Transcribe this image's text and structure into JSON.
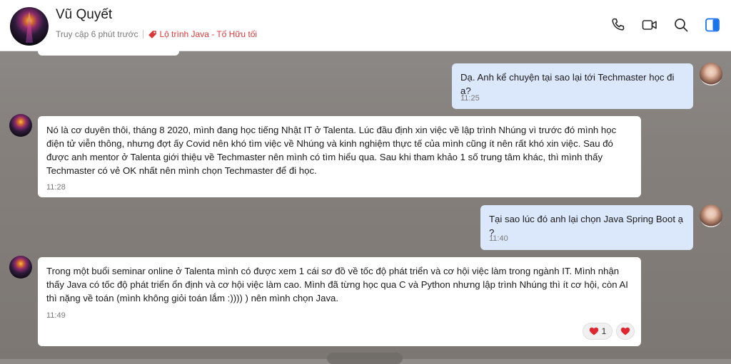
{
  "header": {
    "name": "Vũ Quyết",
    "status": "Truy cập 6 phút trước",
    "tag": "Lộ trình Java - Tố Hữu tối",
    "icons": [
      "phone-icon",
      "video-camera-icon",
      "search-icon",
      "sidebar-toggle-icon"
    ]
  },
  "messages": [
    {
      "id": "m1",
      "direction": "out",
      "text": "Dạ. Anh kể chuyện tại sao lại tới Techmaster học đi ạ?",
      "time": "11:25"
    },
    {
      "id": "m2",
      "direction": "in",
      "text": "Nó là cơ duyên thôi, tháng 8 2020, mình đang học tiếng Nhật IT ở Talenta. Lúc đầu định xin việc về lập trình Nhúng vì trước đó mình học điện tử viễn thông, nhưng đợt ấy Covid nên khó tìm việc về Nhúng và kinh nghiệm thực tế của mình cũng ít nên rất khó xin việc. Sau đó được anh mentor ở Talenta giới thiệu về Techmaster nên mình có tìm hiểu qua. Sau khi tham khảo 1 số trung tâm khác, thì mình thấy Techmaster có vẻ OK nhất nên mình chọn Techmaster để đi học.",
      "time": "11:28"
    },
    {
      "id": "m3",
      "direction": "out",
      "text": "Tại sao lúc đó anh lại chọn Java Spring Boot ạ ?",
      "time": "11:40"
    },
    {
      "id": "m4",
      "direction": "in",
      "text": "Trong một buổi seminar online ở Talenta mình có được xem 1 cái sơ đồ về tốc độ phát triển và cơ hội việc làm trong ngành IT. Mình nhận thấy Java có tốc độ phát triển ổn định và cơ hội việc làm cao. Mình đã từng học qua C và Python nhưng lập trình Nhúng thì ít cơ hội, còn AI thì nặng về toán (mình không giỏi toán lắm :)))) ) nên mình chọn Java.",
      "time": "11:49",
      "reaction_count": "1"
    }
  ],
  "colors": {
    "incoming_bubble": "#ffffff",
    "outgoing_bubble": "#dbe7fb",
    "tag": "#d9383a",
    "accent": "#1a73e8"
  }
}
